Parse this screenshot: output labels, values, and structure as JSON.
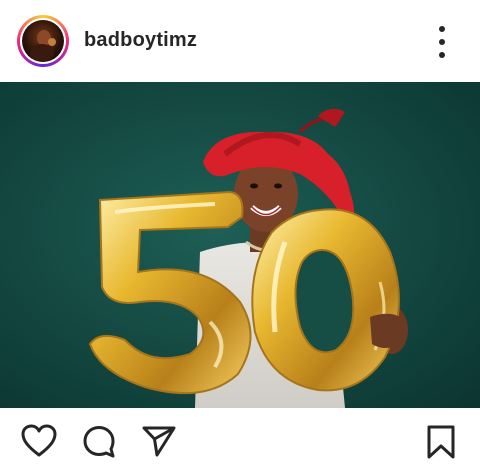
{
  "post": {
    "username": "badboytimz",
    "photo_description_icon": "balloon-photo"
  },
  "icons": {
    "more": "more-vertical-icon",
    "like": "heart-icon",
    "comment": "comment-icon",
    "share": "send-icon",
    "save": "bookmark-icon"
  },
  "colors": {
    "text": "#262626",
    "photo_background": "#134740",
    "hat": "#d8202a",
    "balloon_gold": "#e3b83a"
  }
}
